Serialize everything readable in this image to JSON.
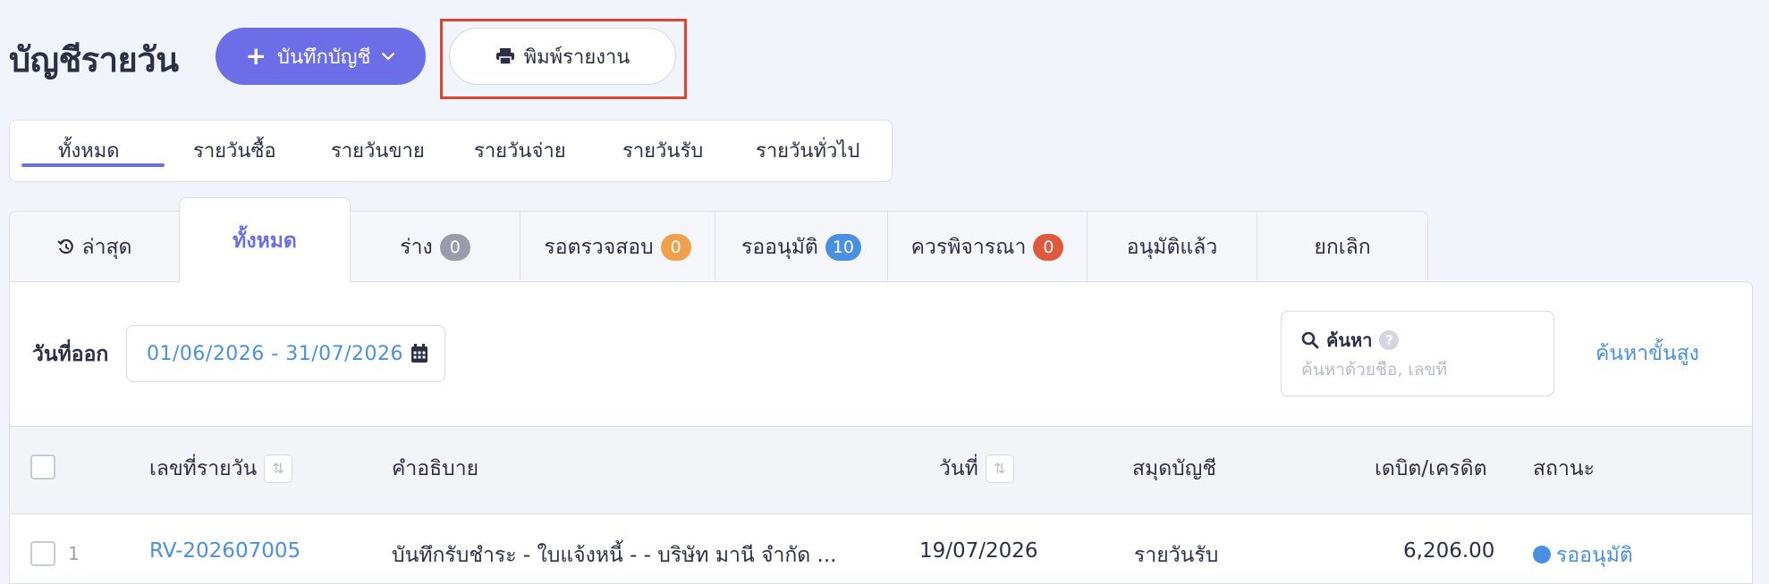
{
  "header": {
    "title": "บัญชีรายวัน",
    "record_button": "บันทึกบัญชี",
    "print_button": "พิมพ์รายงาน"
  },
  "type_tabs": [
    "ทั้งหมด",
    "รายวันซื้อ",
    "รายวันขาย",
    "รายวันจ่าย",
    "รายวันรับ",
    "รายวันทั่วไป"
  ],
  "status_tabs": [
    {
      "label": "ล่าสุด"
    },
    {
      "label": "ทั้งหมด"
    },
    {
      "label": "ร่าง",
      "count": "0",
      "badge_color": "#9b9cab"
    },
    {
      "label": "รอตรวจสอบ",
      "count": "0",
      "badge_color": "#f0a04b"
    },
    {
      "label": "รออนุมัติ",
      "count": "10",
      "badge_color": "#4a90e2"
    },
    {
      "label": "ควรพิจารณา",
      "count": "0",
      "badge_color": "#e0593a"
    },
    {
      "label": "อนุมัติแล้ว"
    },
    {
      "label": "ยกเลิก"
    }
  ],
  "filter": {
    "date_label": "วันที่ออก",
    "date_range": "01/06/2026 - 31/07/2026",
    "search_label": "ค้นหา",
    "search_placeholder": "ค้นหาด้วยชื่อ, เลขที่",
    "advanced_search": "ค้นหาขั้นสูง"
  },
  "table": {
    "columns": [
      "เลขที่รายวัน",
      "คำอธิบาย",
      "วันที่",
      "สมุดบัญชี",
      "เดบิต/เครดิต",
      "สถานะ"
    ],
    "rows": [
      {
        "num": "1",
        "doc_no": "RV-202607005",
        "description": "บันทึกรับชำระ - ใบแจ้งหนี้ - - บริษัท มานี จำกัด ...",
        "date": "19/07/2026",
        "book": "รายวันรับ",
        "amount": "6,206.00",
        "status": "รออนุมัติ"
      }
    ]
  },
  "colors": {
    "primary": "#6c6ee8",
    "link": "#4a90e2",
    "highlight": "#e0432f"
  }
}
